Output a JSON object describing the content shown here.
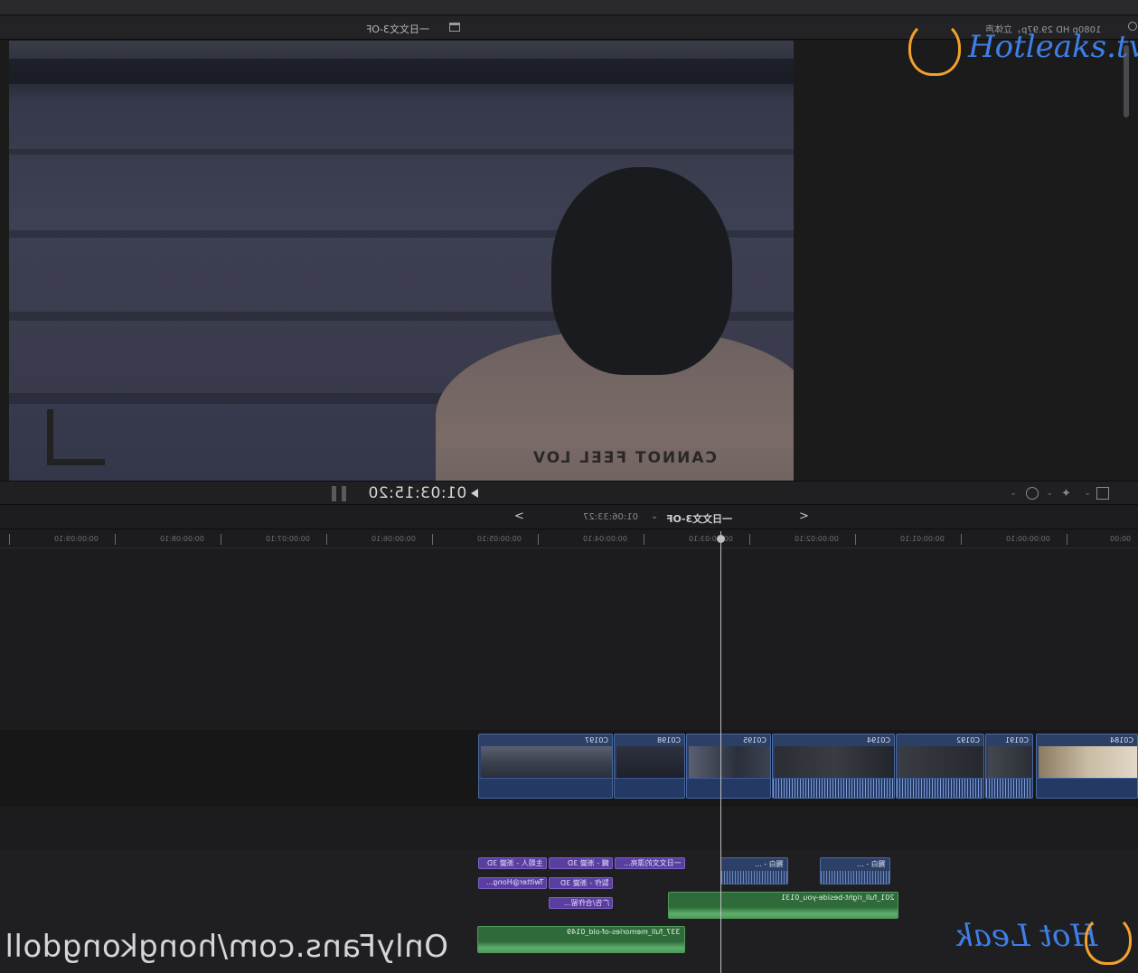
{
  "viewer": {
    "title": "一日文文3-OF",
    "format_label": "1080p HD 29.97p，立体声",
    "timecode": "01:03:15:20",
    "jacket_print": "CANNOT FEEL LOV"
  },
  "timeline": {
    "project_name": "一日文文3-OF",
    "project_duration": "01:06:33:27",
    "ruler_labels": [
      "00:00:09:10",
      "00:00:08:10",
      "00:00:07:10",
      "00:00:06:10",
      "00:00:05:10",
      "00:00:04:10",
      "00:00:03:10",
      "00:00:02:10",
      "00:00:01:10",
      "00:00:00:10",
      "00:00"
    ],
    "primary_clips": [
      "C0197",
      "C0198",
      "C0195",
      "C0194",
      "C0192",
      "C0191",
      "C0184"
    ],
    "title_clips": [
      "一日文文的漂亮...",
      "鐵 - 漸變 3D",
      "主題人 - 漸變 3D",
      "製作 - 漸變 3D",
      "Twitter@Hong...",
      "广告/合作留..."
    ],
    "voice_clips": [
      "獨白 - ...",
      "獨白 - ..."
    ],
    "music_clips": [
      "201_full_right-beside-you_0131",
      "337_full_memories-of-old_0149"
    ]
  },
  "watermarks": {
    "top_brand": "Hotleaks.tv",
    "bottom_brand": "Hot Leak",
    "url": "OnlyFans.com/hongkongdoll"
  },
  "colors": {
    "background": "#1b1b1c",
    "video_clip": "#2c3f66",
    "title_clip": "#5a3ea0",
    "music_clip": "#2f6b3a",
    "watermark_blue": "#3f7fe8",
    "watermark_orange": "#f2a12c"
  }
}
